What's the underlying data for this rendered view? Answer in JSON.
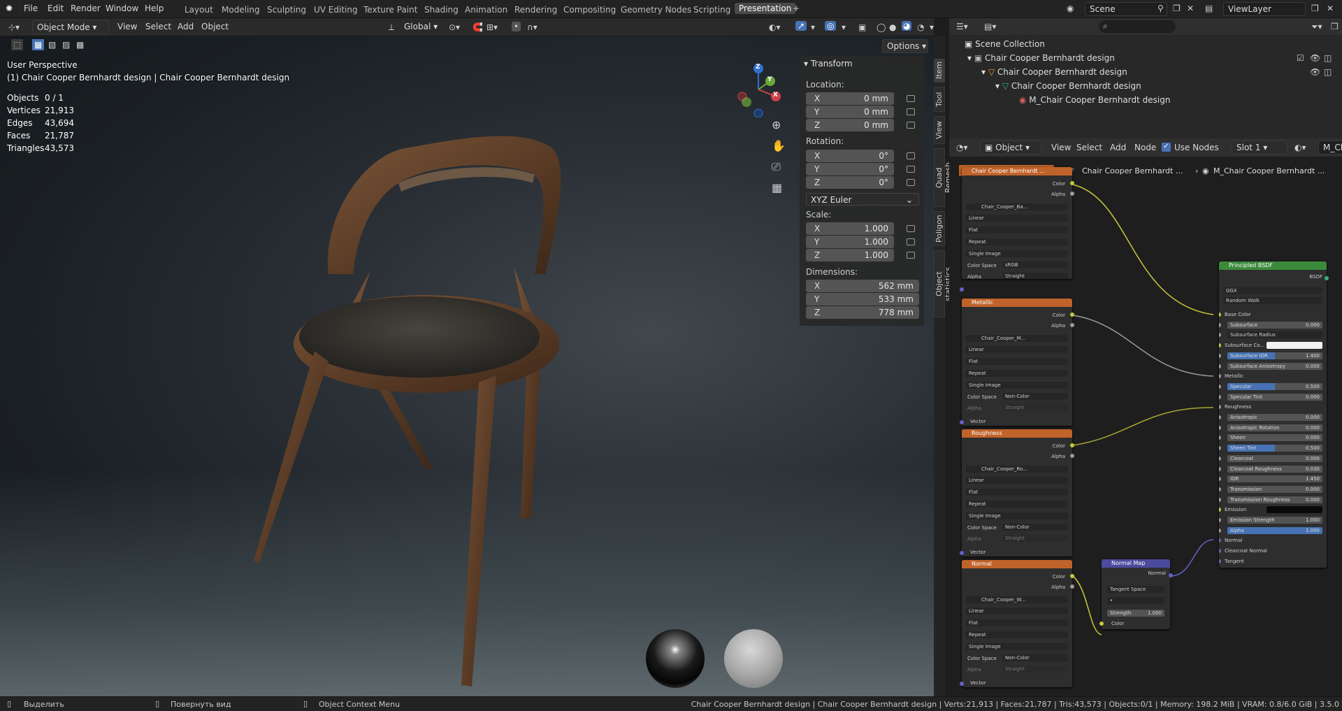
{
  "topbar": {
    "menus": [
      "File",
      "Edit",
      "Render",
      "Window",
      "Help"
    ],
    "workspaces": [
      "Layout",
      "Modeling",
      "Sculpting",
      "UV Editing",
      "Texture Paint",
      "Shading",
      "Animation",
      "Rendering",
      "Compositing",
      "Geometry Nodes",
      "Scripting",
      "Presentation"
    ],
    "active_workspace": "Presentation",
    "scene": "Scene",
    "view_layer": "ViewLayer"
  },
  "viewport_header": {
    "mode": "Object Mode",
    "menus": [
      "View",
      "Select",
      "Add",
      "Object"
    ],
    "transform_orientation": "Global",
    "options": "Options"
  },
  "viewport": {
    "perspective": "User Perspective",
    "object_info": "(1) Chair Cooper Bernhardt design | Chair Cooper Bernhardt design",
    "stats": [
      {
        "label": "Objects",
        "value": "0 / 1"
      },
      {
        "label": "Vertices",
        "value": "21,913"
      },
      {
        "label": "Edges",
        "value": "43,694"
      },
      {
        "label": "Faces",
        "value": "21,787"
      },
      {
        "label": "Triangles",
        "value": "43,573"
      }
    ],
    "gizmo": {
      "z": "Z",
      "y": "Y",
      "x": "X"
    }
  },
  "npanel": {
    "title": "Transform",
    "location_label": "Location:",
    "location": [
      {
        "axis": "X",
        "value": "0 mm"
      },
      {
        "axis": "Y",
        "value": "0 mm"
      },
      {
        "axis": "Z",
        "value": "0 mm"
      }
    ],
    "rotation_label": "Rotation:",
    "rotation": [
      {
        "axis": "X",
        "value": "0°"
      },
      {
        "axis": "Y",
        "value": "0°"
      },
      {
        "axis": "Z",
        "value": "0°"
      }
    ],
    "rotation_mode": "XYZ Euler",
    "scale_label": "Scale:",
    "scale": [
      {
        "axis": "X",
        "value": "1.000"
      },
      {
        "axis": "Y",
        "value": "1.000"
      },
      {
        "axis": "Z",
        "value": "1.000"
      }
    ],
    "dimensions_label": "Dimensions:",
    "dimensions": [
      {
        "axis": "X",
        "value": "562 mm"
      },
      {
        "axis": "Y",
        "value": "533 mm"
      },
      {
        "axis": "Z",
        "value": "778 mm"
      }
    ],
    "tabs": [
      "Item",
      "Tool",
      "View",
      "Quad Remesh",
      "Poligon",
      "Object statistics"
    ]
  },
  "outliner": {
    "rows": [
      "Scene Collection",
      "Chair Cooper Bernhardt design",
      "Chair Cooper Bernhardt design",
      "Chair Cooper Bernhardt design",
      "M_Chair Cooper Bernhardt design"
    ]
  },
  "node_header": {
    "type": "Object",
    "menus": [
      "View",
      "Select",
      "Add",
      "Node"
    ],
    "use_nodes": "Use Nodes",
    "slot": "Slot 1",
    "material": "M_Cha"
  },
  "breadcrumb": [
    "Chair Cooper Bernhardt ...",
    "M_Chair Cooper Bernhardt ..."
  ],
  "nodes": {
    "tex_nodes": [
      {
        "title": "Chair Cooper Bernhardt ...",
        "image": "Chair_Cooper_Ba...",
        "color_space": "sRGB",
        "alpha": "Straight"
      },
      {
        "title": "Metallic",
        "image": "Chair_Cooper_M...",
        "color_space": "Non-Color",
        "alpha": "Straight"
      },
      {
        "title": "Roughness",
        "image": "Chair_Cooper_Ro...",
        "color_space": "Non-Color",
        "alpha": "Straight"
      },
      {
        "title": "Normal",
        "image": "Chair_Cooper_W...",
        "color_space": "Non-Color",
        "alpha": "Straight"
      }
    ],
    "tex_labels": {
      "color": "Color",
      "alpha": "Alpha",
      "vector": "Vector",
      "interp": "Linear",
      "proj": "Flat",
      "ext": "Repeat",
      "src": "Single Image",
      "cs": "Color Space",
      "al": "Alpha"
    },
    "normal_map": {
      "title": "Normal Map",
      "out": "Normal",
      "space": "Tangent Space",
      "strength_label": "Strength",
      "strength": "1.000",
      "in": "Color"
    },
    "bsdf": {
      "title": "Principled BSDF",
      "out": "BSDF",
      "dist": "GGX",
      "sss": "Random Walk",
      "rows": [
        {
          "label": "Base Color",
          "kind": "socket"
        },
        {
          "label": "Subsurface",
          "value": "0.000",
          "kind": "bar"
        },
        {
          "label": "Subsurface Radius",
          "kind": "drop"
        },
        {
          "label": "Subsurface Co...",
          "kind": "white"
        },
        {
          "label": "Subsurface IOR",
          "value": "1.400",
          "kind": "barfill"
        },
        {
          "label": "Subsurface Anisotropy",
          "value": "0.000",
          "kind": "bar"
        },
        {
          "label": "Metallic",
          "kind": "socket"
        },
        {
          "label": "Specular",
          "value": "0.500",
          "kind": "barfill"
        },
        {
          "label": "Specular Tint",
          "value": "0.000",
          "kind": "bar"
        },
        {
          "label": "Roughness",
          "kind": "socket"
        },
        {
          "label": "Anisotropic",
          "value": "0.000",
          "kind": "bar"
        },
        {
          "label": "Anisotropic Rotation",
          "value": "0.000",
          "kind": "bar"
        },
        {
          "label": "Sheen",
          "value": "0.000",
          "kind": "bar"
        },
        {
          "label": "Sheen Tint",
          "value": "0.500",
          "kind": "barfill"
        },
        {
          "label": "Clearcoat",
          "value": "0.000",
          "kind": "bar"
        },
        {
          "label": "Clearcoat Roughness",
          "value": "0.030",
          "kind": "bar"
        },
        {
          "label": "IOR",
          "value": "1.450",
          "kind": "bar"
        },
        {
          "label": "Transmission",
          "value": "0.000",
          "kind": "bar"
        },
        {
          "label": "Transmission Roughness",
          "value": "0.000",
          "kind": "bar"
        },
        {
          "label": "Emission",
          "kind": "black"
        },
        {
          "label": "Emission Strength",
          "value": "1.000",
          "kind": "bar"
        },
        {
          "label": "Alpha",
          "value": "1.000",
          "kind": "barfull"
        },
        {
          "label": "Normal",
          "kind": "socket"
        },
        {
          "label": "Clearcoat Normal",
          "kind": "socket"
        },
        {
          "label": "Tangent",
          "kind": "socket"
        }
      ]
    }
  },
  "statusbar": {
    "select": "Выделить",
    "rotate": "Повернуть вид",
    "context": "Object Context Menu",
    "info": "Chair Cooper Bernhardt design | Chair Cooper Bernhardt design | Verts:21,913 | Faces:21,787 | Tris:43,573 | Objects:0/1 | Memory: 198.2 MiB | VRAM: 0.8/6.0 GiB | 3.5.0"
  },
  "colors": {
    "accent": "#4772b3",
    "node_image": "#c0632a",
    "node_bsdf": "#3b8a3b",
    "node_normalmap": "#4b4b9e",
    "link_yellow": "#c8c83c",
    "link_grey": "#9a9a9a",
    "link_purple": "#6363c7"
  }
}
